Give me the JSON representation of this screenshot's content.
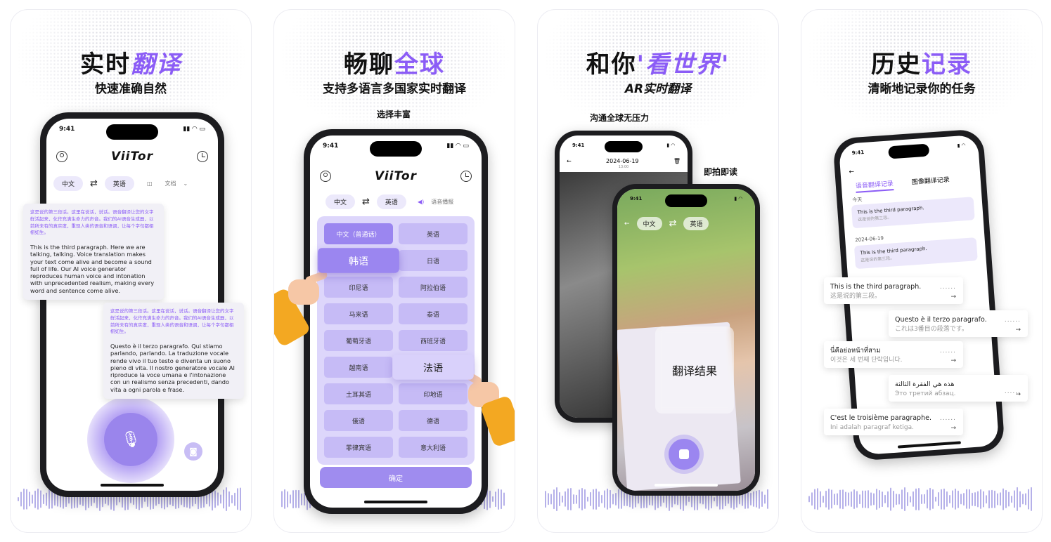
{
  "cards": [
    {
      "title_a": "实时",
      "title_b": "翻译",
      "subtitle": "快速准确自然",
      "phone": {
        "time": "9:41",
        "logo": "ViiTor",
        "lang_from": "中文",
        "lang_to": "英语",
        "mode": "文档",
        "bubble1_cn": "这是说的第三段话。这里在说话，说话。语音翻译让您的文字鲜活起来，化作充满生命力的声音。我们的AI语音生成器，以前所未有的真实度，重现人类的语音和语调，让每个字句都栩栩如生。",
        "bubble1_en": "This is the third paragraph. Here we are talking, talking. Voice translation makes your text come alive and become a sound full of life. Our AI voice generator reproduces human voice and intonation with unprecedented realism, making every word and sentence come alive.",
        "bubble2_cn": "这是说的第三段话。这里在说话，说话。语音翻译让您的文字鲜活起来，化作充满生命力的声音。我们的AI语音生成器，以前所未有的真实度，重现人类的语音和语调，让每个字句都栩栩如生。",
        "bubble2_it": "Questo è il terzo paragrafo. Qui stiamo parlando, parlando. La traduzione vocale rende vivo il tuo testo e diventa un suono pieno di vita. Il nostro generatore vocale AI riproduce la voce umana e l'intonazione con un realismo senza precedenti, dando vita a ogni parola e frase."
      }
    },
    {
      "title_a": "畅聊",
      "title_b": "全球",
      "subtitle": "支持多语言多国家实时翻译",
      "caption": "选择丰富",
      "phone": {
        "time": "9:41",
        "logo": "ViiTor",
        "lang_from": "中文",
        "lang_to": "英语",
        "voice": "语音播报",
        "languages": [
          "中文（普通话）",
          "英语",
          "韩语",
          "日语",
          "印尼语",
          "阿拉伯语",
          "马来语",
          "泰语",
          "葡萄牙语",
          "西班牙语",
          "越南语",
          "法语",
          "土耳其语",
          "印地语",
          "俄语",
          "德语",
          "菲律宾语",
          "意大利语"
        ],
        "confirm": "确定"
      }
    },
    {
      "title_a": "和你",
      "title_b": "'看世界'",
      "subtitle": "AR实时翻译",
      "caption1": "沟通全球无压力",
      "caption2": "即拍即读",
      "back_phone": {
        "time": "9:41",
        "date": "2024-06-19",
        "subdate": "13:00"
      },
      "front_phone": {
        "time": "9:41",
        "lang_from": "中文",
        "lang_to": "英语",
        "result": "翻译结果"
      }
    },
    {
      "title_a": "历史",
      "title_b": "记录",
      "subtitle": "清晰地记录你的任务",
      "phone": {
        "time": "9:41",
        "tab1": "语音翻译记录",
        "tab2": "图像翻译记录",
        "today": "今天",
        "date2": "2024-06-19",
        "h1_a": "This is the third paragraph.",
        "h1_b": "这是说的第三段。",
        "h2_a": "This is the third paragraph.",
        "h2_b": "这是说的第三段。"
      },
      "rows": [
        {
          "a": "This is the third paragraph.",
          "b": "这是说的第三段。"
        },
        {
          "a": "Questo è il terzo paragrafo.",
          "b": "これは3番目の段落です。"
        },
        {
          "a": "นี่คือย่อหน้าที่สาม",
          "b": "이것은 세 번째 단락입니다."
        },
        {
          "a": "هذه هي الفقرة الثالثة",
          "b": "Это третий абзац."
        },
        {
          "a": "C'est le troisième paragraphe.",
          "b": "Ini adalah paragraf ketiga."
        }
      ]
    }
  ]
}
